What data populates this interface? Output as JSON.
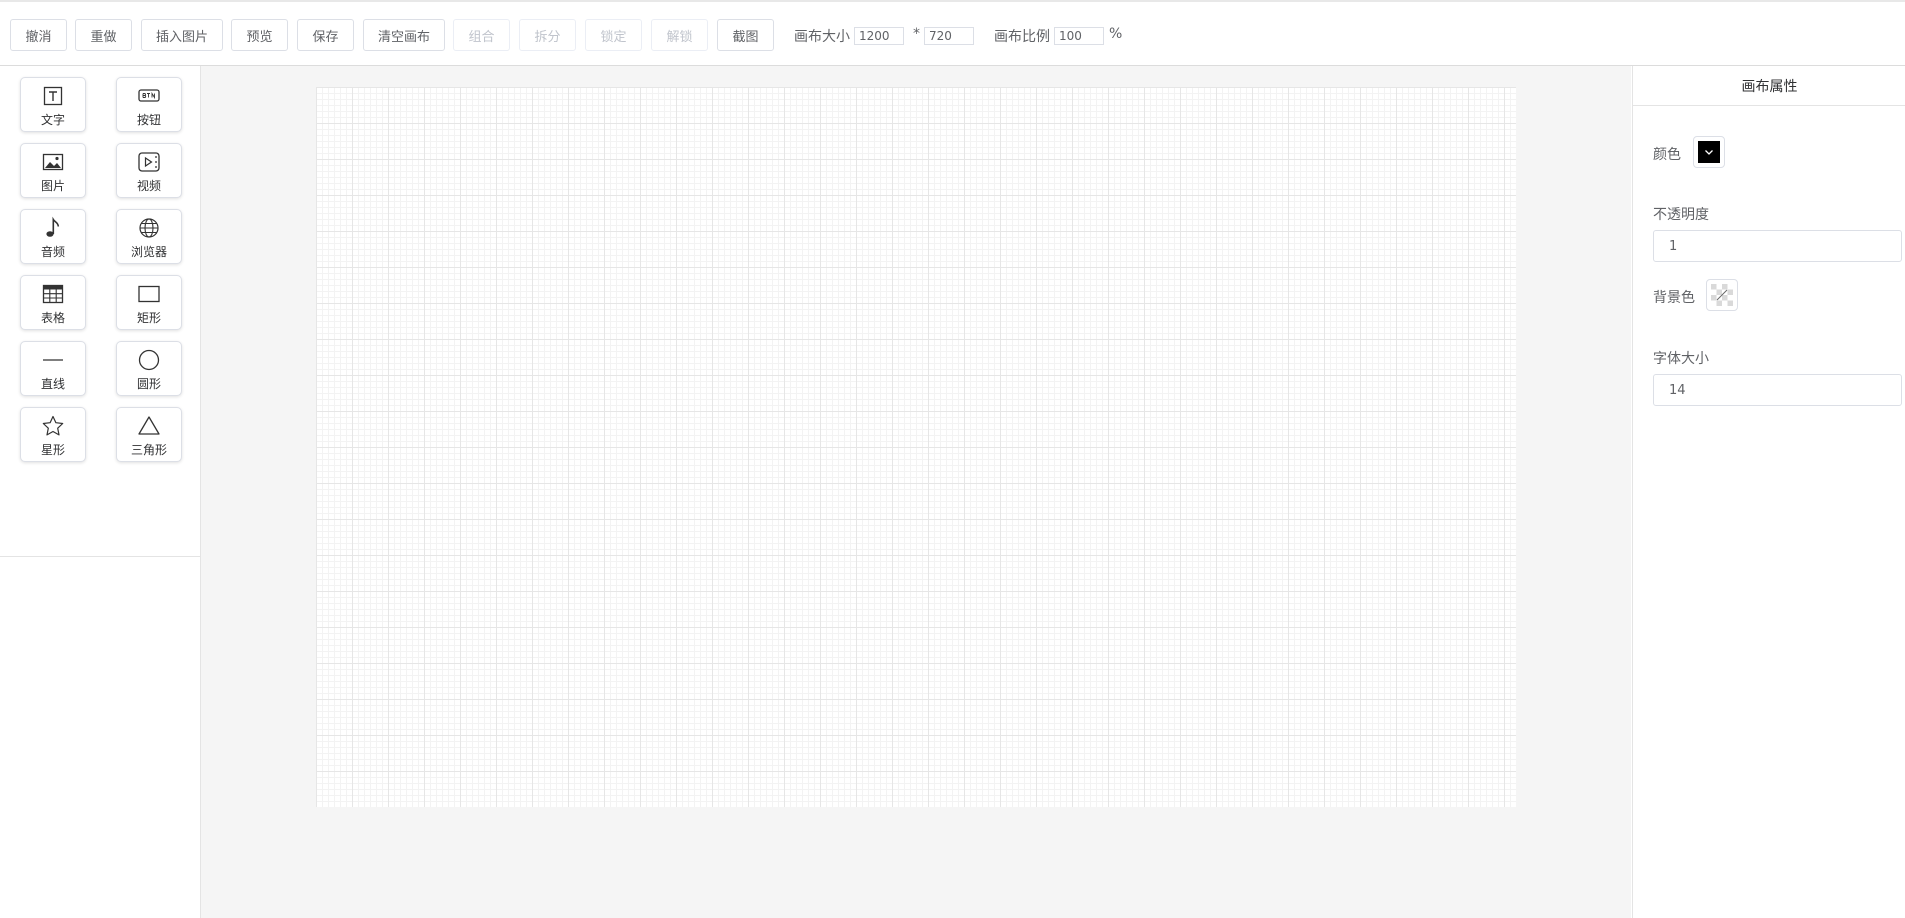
{
  "toolbar": {
    "buttons": [
      {
        "label": "撤消",
        "disabled": false
      },
      {
        "label": "重做",
        "disabled": false
      },
      {
        "label": "插入图片",
        "disabled": false
      },
      {
        "label": "预览",
        "disabled": false
      },
      {
        "label": "保存",
        "disabled": false
      },
      {
        "label": "清空画布",
        "disabled": false
      },
      {
        "label": "组合",
        "disabled": true
      },
      {
        "label": "拆分",
        "disabled": true
      },
      {
        "label": "锁定",
        "disabled": true
      },
      {
        "label": "解锁",
        "disabled": true
      },
      {
        "label": "截图",
        "disabled": false
      }
    ],
    "canvas_size_label": "画布大小",
    "canvas_width": "1200",
    "size_separator": "*",
    "canvas_height": "720",
    "canvas_scale_label": "画布比例",
    "canvas_scale": "100",
    "percent_sign": "%"
  },
  "components": [
    {
      "label": "文字",
      "icon": "text-icon"
    },
    {
      "label": "按钮",
      "icon": "button-icon"
    },
    {
      "label": "图片",
      "icon": "picture-icon"
    },
    {
      "label": "视频",
      "icon": "video-icon"
    },
    {
      "label": "音频",
      "icon": "music-note-icon"
    },
    {
      "label": "浏览器",
      "icon": "globe-icon"
    },
    {
      "label": "表格",
      "icon": "table-icon"
    },
    {
      "label": "矩形",
      "icon": "rectangle-icon"
    },
    {
      "label": "直线",
      "icon": "line-icon"
    },
    {
      "label": "圆形",
      "icon": "circle-icon"
    },
    {
      "label": "星形",
      "icon": "star-icon"
    },
    {
      "label": "三角形",
      "icon": "triangle-icon"
    }
  ],
  "properties": {
    "title": "画布属性",
    "color_label": "颜色",
    "color_value": "#000000",
    "opacity_label": "不透明度",
    "opacity_value": "1",
    "bg_color_label": "背景色",
    "font_size_label": "字体大小",
    "font_size_value": "14"
  },
  "colors": {
    "canvas_bg": "#ffffff",
    "workspace_bg": "#f5f5f5",
    "grid_major": "#e6e6e6",
    "grid_minor": "#f3f3f3"
  }
}
